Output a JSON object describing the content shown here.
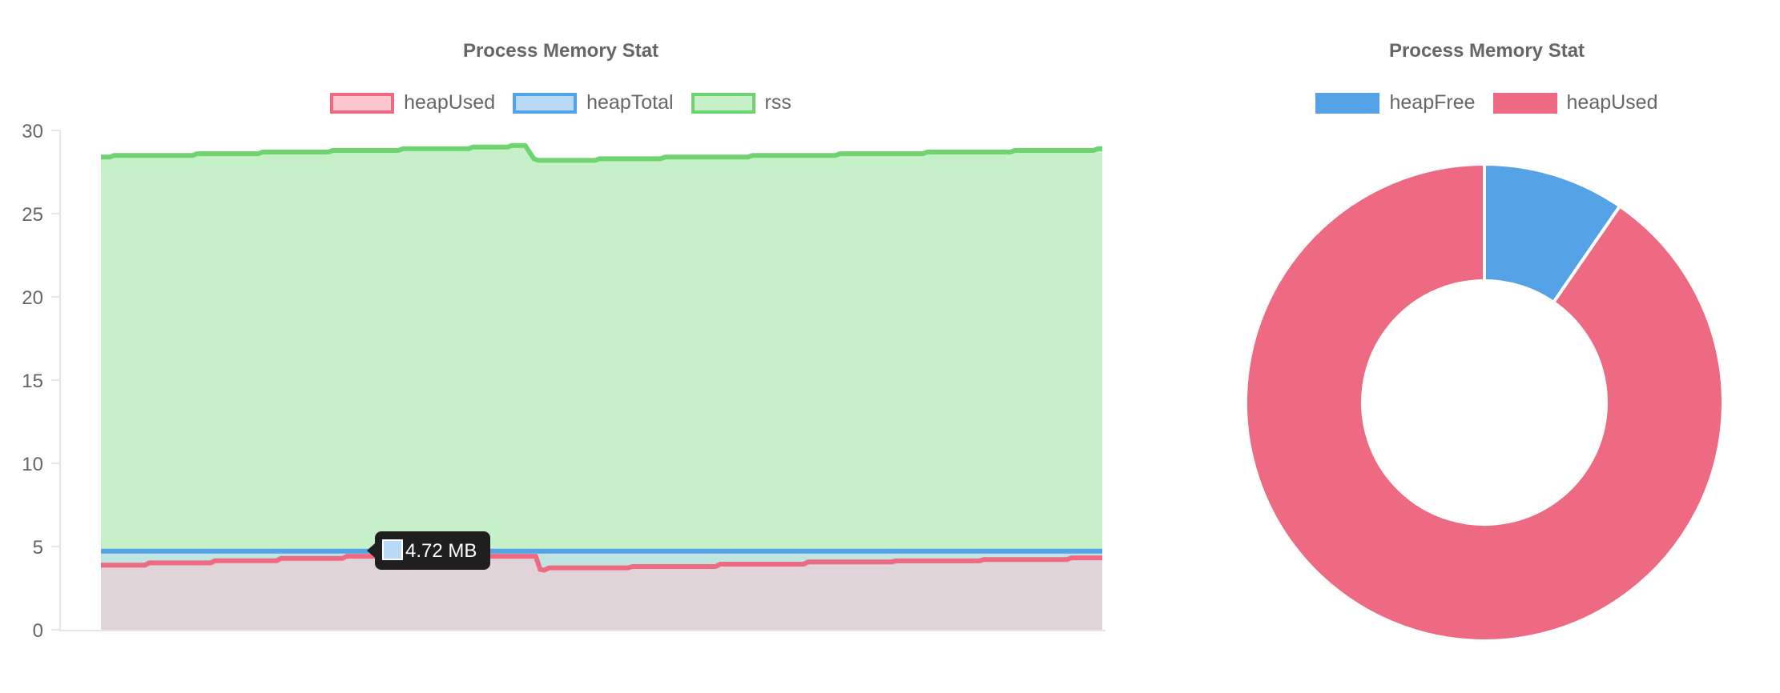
{
  "charts": [
    {
      "title": "Process Memory Stat",
      "legend": [
        {
          "label": "heapUsed",
          "border": "#ee6a82",
          "fill": "#fcc6d0"
        },
        {
          "label": "heapTotal",
          "border": "#55a2e6",
          "fill": "#b9daf7"
        },
        {
          "label": "rss",
          "border": "#6dd46f",
          "fill": "#c6f0c7"
        }
      ],
      "tooltip": {
        "text": "4.72 MB"
      }
    },
    {
      "title": "Process Memory Stat",
      "legend": [
        {
          "label": "heapFree",
          "color": "#55a2e6"
        },
        {
          "label": "heapUsed",
          "color": "#ee6a82"
        }
      ]
    }
  ],
  "chart_data": [
    {
      "type": "area",
      "title": "Process Memory Stat",
      "ylim": [
        0,
        30
      ],
      "yticks": [
        0,
        5,
        10,
        15,
        20,
        25,
        30
      ],
      "grid": false,
      "legend_position": "top",
      "unit": "MB",
      "series": [
        {
          "name": "heapUsed",
          "color": "#ee6a82",
          "fill": "#fcc6d0",
          "values": [
            3.88,
            3.88,
            3.88,
            3.88,
            3.88,
            3.88,
            3.88,
            3.88,
            3.88,
            3.88,
            3.88,
            4.02,
            4.02,
            4.02,
            4.02,
            4.02,
            4.02,
            4.02,
            4.02,
            4.02,
            4.02,
            4.02,
            4.02,
            4.02,
            4.02,
            4.02,
            4.15,
            4.15,
            4.15,
            4.15,
            4.15,
            4.15,
            4.15,
            4.15,
            4.15,
            4.15,
            4.15,
            4.15,
            4.15,
            4.15,
            4.15,
            4.29,
            4.29,
            4.29,
            4.29,
            4.29,
            4.29,
            4.29,
            4.29,
            4.29,
            4.29,
            4.29,
            4.29,
            4.29,
            4.29,
            4.29,
            4.42,
            4.42,
            4.42,
            4.42,
            4.42,
            4.42,
            4.42,
            4.42,
            4.42,
            4.42,
            4.42,
            4.42,
            4.42,
            4.42,
            4.42,
            4.42,
            4.42,
            4.42,
            4.42,
            4.42,
            4.42,
            4.42,
            4.42,
            4.42,
            4.42,
            4.42,
            4.42,
            4.42,
            4.42,
            4.42,
            4.42,
            4.42,
            4.42,
            4.42,
            4.42,
            4.42,
            4.42,
            4.42,
            4.42,
            4.42,
            4.42,
            4.42,
            4.42,
            4.42,
            3.63,
            3.58,
            3.72,
            3.72,
            3.72,
            3.72,
            3.72,
            3.72,
            3.72,
            3.72,
            3.72,
            3.72,
            3.72,
            3.72,
            3.72,
            3.72,
            3.72,
            3.72,
            3.72,
            3.72,
            3.72,
            3.8,
            3.8,
            3.8,
            3.8,
            3.8,
            3.8,
            3.8,
            3.8,
            3.8,
            3.8,
            3.8,
            3.8,
            3.8,
            3.8,
            3.8,
            3.8,
            3.8,
            3.8,
            3.8,
            3.8,
            3.94,
            3.94,
            3.94,
            3.94,
            3.94,
            3.94,
            3.94,
            3.94,
            3.94,
            3.94,
            3.94,
            3.94,
            3.94,
            3.94,
            3.94,
            3.94,
            3.94,
            3.94,
            3.94,
            3.94,
            4.07,
            4.07,
            4.07,
            4.07,
            4.07,
            4.07,
            4.07,
            4.07,
            4.07,
            4.07,
            4.07,
            4.07,
            4.07,
            4.07,
            4.07,
            4.07,
            4.07,
            4.07,
            4.07,
            4.07,
            4.14,
            4.14,
            4.14,
            4.14,
            4.14,
            4.14,
            4.14,
            4.14,
            4.14,
            4.14,
            4.14,
            4.14,
            4.14,
            4.14,
            4.14,
            4.14,
            4.14,
            4.14,
            4.14,
            4.14,
            4.22,
            4.22,
            4.22,
            4.22,
            4.22,
            4.22,
            4.22,
            4.22,
            4.22,
            4.22,
            4.22,
            4.22,
            4.22,
            4.22,
            4.22,
            4.22,
            4.22,
            4.22,
            4.22,
            4.22,
            4.32,
            4.32,
            4.32,
            4.32,
            4.32,
            4.32,
            4.32,
            4.32
          ]
        },
        {
          "name": "heapTotal",
          "color": "#55a2e6",
          "fill": "#b9daf7",
          "values": [
            4.72,
            4.72,
            4.72,
            4.72,
            4.72,
            4.72,
            4.72,
            4.72,
            4.72,
            4.72,
            4.72,
            4.72,
            4.72,
            4.72,
            4.72,
            4.72,
            4.72,
            4.72,
            4.72,
            4.72,
            4.72,
            4.72,
            4.72,
            4.72,
            4.72,
            4.72,
            4.72,
            4.72,
            4.72,
            4.72,
            4.72,
            4.72,
            4.72,
            4.72,
            4.72,
            4.72,
            4.72,
            4.72,
            4.72,
            4.72,
            4.72,
            4.72,
            4.72,
            4.72,
            4.72,
            4.72,
            4.72,
            4.72,
            4.72,
            4.72,
            4.72,
            4.72,
            4.72,
            4.72,
            4.72,
            4.72,
            4.72,
            4.72,
            4.72,
            4.72,
            4.72,
            4.72,
            4.72,
            4.72,
            4.72,
            4.72,
            4.72,
            4.72,
            4.72,
            4.72,
            4.72,
            4.72,
            4.72,
            4.72,
            4.72,
            4.72,
            4.72,
            4.72,
            4.72,
            4.72,
            4.72,
            4.72,
            4.72,
            4.72,
            4.72,
            4.72,
            4.72,
            4.72,
            4.72,
            4.72,
            4.72,
            4.72,
            4.72,
            4.72,
            4.72,
            4.72,
            4.72,
            4.72,
            4.72,
            4.72,
            4.72,
            4.72,
            4.72,
            4.72,
            4.72,
            4.72,
            4.72,
            4.72,
            4.72,
            4.72,
            4.72,
            4.72,
            4.72,
            4.72,
            4.72,
            4.72,
            4.72,
            4.72,
            4.72,
            4.72,
            4.72,
            4.72,
            4.72,
            4.72,
            4.72,
            4.72,
            4.72,
            4.72,
            4.72,
            4.72,
            4.72,
            4.72,
            4.72,
            4.72,
            4.72,
            4.72,
            4.72,
            4.72,
            4.72,
            4.72,
            4.72,
            4.72,
            4.72,
            4.72,
            4.72,
            4.72,
            4.72,
            4.72,
            4.72,
            4.72,
            4.72,
            4.72,
            4.72,
            4.72,
            4.72,
            4.72,
            4.72,
            4.72,
            4.72,
            4.72,
            4.72,
            4.72,
            4.72,
            4.72,
            4.72,
            4.72,
            4.72,
            4.72,
            4.72,
            4.72,
            4.72,
            4.72,
            4.72,
            4.72,
            4.72,
            4.72,
            4.72,
            4.72,
            4.72,
            4.72,
            4.72,
            4.72,
            4.72,
            4.72,
            4.72,
            4.72,
            4.72,
            4.72,
            4.72,
            4.72,
            4.72,
            4.72,
            4.72,
            4.72,
            4.72,
            4.72,
            4.72,
            4.72,
            4.72,
            4.72,
            4.72,
            4.72,
            4.72,
            4.72,
            4.72,
            4.72,
            4.72,
            4.72,
            4.72,
            4.72,
            4.72,
            4.72,
            4.72,
            4.72,
            4.72,
            4.72,
            4.72,
            4.72,
            4.72,
            4.72,
            4.72,
            4.72,
            4.72,
            4.72,
            4.72,
            4.72,
            4.72,
            4.72,
            4.72,
            4.72,
            4.72,
            4.72
          ]
        },
        {
          "name": "rss",
          "color": "#6dd46f",
          "fill": "#c6f0c7",
          "values": [
            28.4,
            28.4,
            28.4,
            28.5,
            28.5,
            28.5,
            28.5,
            28.5,
            28.5,
            28.5,
            28.5,
            28.5,
            28.5,
            28.5,
            28.5,
            28.5,
            28.5,
            28.5,
            28.5,
            28.5,
            28.5,
            28.5,
            28.6,
            28.6,
            28.6,
            28.6,
            28.6,
            28.6,
            28.6,
            28.6,
            28.6,
            28.6,
            28.6,
            28.6,
            28.6,
            28.6,
            28.6,
            28.7,
            28.7,
            28.7,
            28.7,
            28.7,
            28.7,
            28.7,
            28.7,
            28.7,
            28.7,
            28.7,
            28.7,
            28.7,
            28.7,
            28.7,
            28.7,
            28.8,
            28.8,
            28.8,
            28.8,
            28.8,
            28.8,
            28.8,
            28.8,
            28.8,
            28.8,
            28.8,
            28.8,
            28.8,
            28.8,
            28.8,
            28.8,
            28.9,
            28.9,
            28.9,
            28.9,
            28.9,
            28.9,
            28.9,
            28.9,
            28.9,
            28.9,
            28.9,
            28.9,
            28.9,
            28.9,
            28.9,
            28.9,
            29,
            29,
            29,
            29,
            29,
            29,
            29,
            29,
            29,
            29.1,
            29.1,
            29.1,
            29.1,
            28.7,
            28.3,
            28.2,
            28.2,
            28.2,
            28.2,
            28.2,
            28.2,
            28.2,
            28.2,
            28.2,
            28.2,
            28.2,
            28.2,
            28.2,
            28.2,
            28.3,
            28.3,
            28.3,
            28.3,
            28.3,
            28.3,
            28.3,
            28.3,
            28.3,
            28.3,
            28.3,
            28.3,
            28.3,
            28.3,
            28.3,
            28.4,
            28.4,
            28.4,
            28.4,
            28.4,
            28.4,
            28.4,
            28.4,
            28.4,
            28.4,
            28.4,
            28.4,
            28.4,
            28.4,
            28.4,
            28.4,
            28.4,
            28.4,
            28.4,
            28.4,
            28.5,
            28.5,
            28.5,
            28.5,
            28.5,
            28.5,
            28.5,
            28.5,
            28.5,
            28.5,
            28.5,
            28.5,
            28.5,
            28.5,
            28.5,
            28.5,
            28.5,
            28.5,
            28.5,
            28.5,
            28.6,
            28.6,
            28.6,
            28.6,
            28.6,
            28.6,
            28.6,
            28.6,
            28.6,
            28.6,
            28.6,
            28.6,
            28.6,
            28.6,
            28.6,
            28.6,
            28.6,
            28.6,
            28.6,
            28.6,
            28.7,
            28.7,
            28.7,
            28.7,
            28.7,
            28.7,
            28.7,
            28.7,
            28.7,
            28.7,
            28.7,
            28.7,
            28.7,
            28.7,
            28.7,
            28.7,
            28.7,
            28.7,
            28.7,
            28.7,
            28.8,
            28.8,
            28.8,
            28.8,
            28.8,
            28.8,
            28.8,
            28.8,
            28.8,
            28.8,
            28.8,
            28.8,
            28.8,
            28.8,
            28.8,
            28.8,
            28.8,
            28.8,
            28.8,
            28.9,
            28.9
          ]
        }
      ]
    },
    {
      "type": "pie",
      "title": "Process Memory Stat",
      "legend_position": "top",
      "donut": true,
      "categories": [
        "heapFree",
        "heapUsed"
      ],
      "values": [
        9.6,
        90.4
      ],
      "colors": [
        "#55a2e6",
        "#ee6a82"
      ]
    }
  ]
}
